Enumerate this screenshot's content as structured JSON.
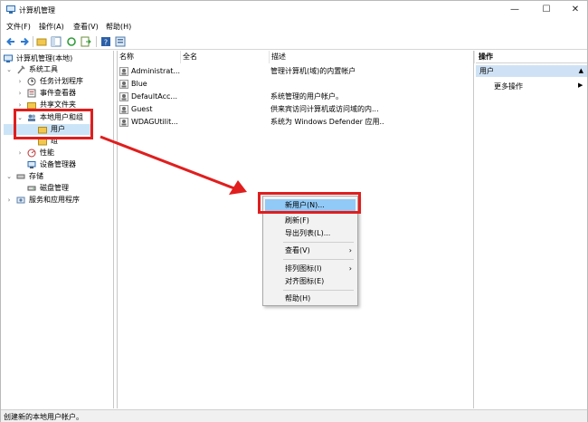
{
  "window": {
    "title": "计算机管理"
  },
  "window_controls": {
    "minimize": "—",
    "maximize": "☐",
    "close": "✕"
  },
  "menu": [
    "文件(F)",
    "操作(A)",
    "查看(V)",
    "帮助(H)"
  ],
  "tree": {
    "root": "计算机管理(本地)",
    "system_tools": "系统工具",
    "task_scheduler": "任务计划程序",
    "event_viewer": "事件查看器",
    "shared_folders": "共享文件夹",
    "local_users": "本地用户和组",
    "users": "用户",
    "groups": "组",
    "performance": "性能",
    "device_manager": "设备管理器",
    "storage": "存储",
    "disk_management": "磁盘管理",
    "services": "服务和应用程序"
  },
  "columns": {
    "name": "名称",
    "fullname": "全名",
    "description": "描述"
  },
  "users": [
    {
      "name": "Administrat...",
      "description": "管理计算机(域)的内置帐户"
    },
    {
      "name": "Blue",
      "description": ""
    },
    {
      "name": "DefaultAcc...",
      "description": "系统管理的用户帐户。"
    },
    {
      "name": "Guest",
      "description": "供来宾访问计算机或访问域的内..."
    },
    {
      "name": "WDAGUtilit...",
      "description": "系统为 Windows Defender 应用..."
    }
  ],
  "actions": {
    "header": "操作",
    "selected": "用户",
    "more": "更多操作"
  },
  "context_menu": {
    "new_user": "新用户(N)...",
    "refresh": "刷新(F)",
    "export": "导出列表(L)...",
    "view": "查看(V)",
    "arrange": "排列图标(I)",
    "align": "对齐图标(E)",
    "help": "帮助(H)"
  },
  "status": "创建新的本地用户帐户。",
  "colors": {
    "highlight": "#91c9f7",
    "annotation_red": "#e01e1e",
    "action_selected": "#cfe2f5"
  }
}
